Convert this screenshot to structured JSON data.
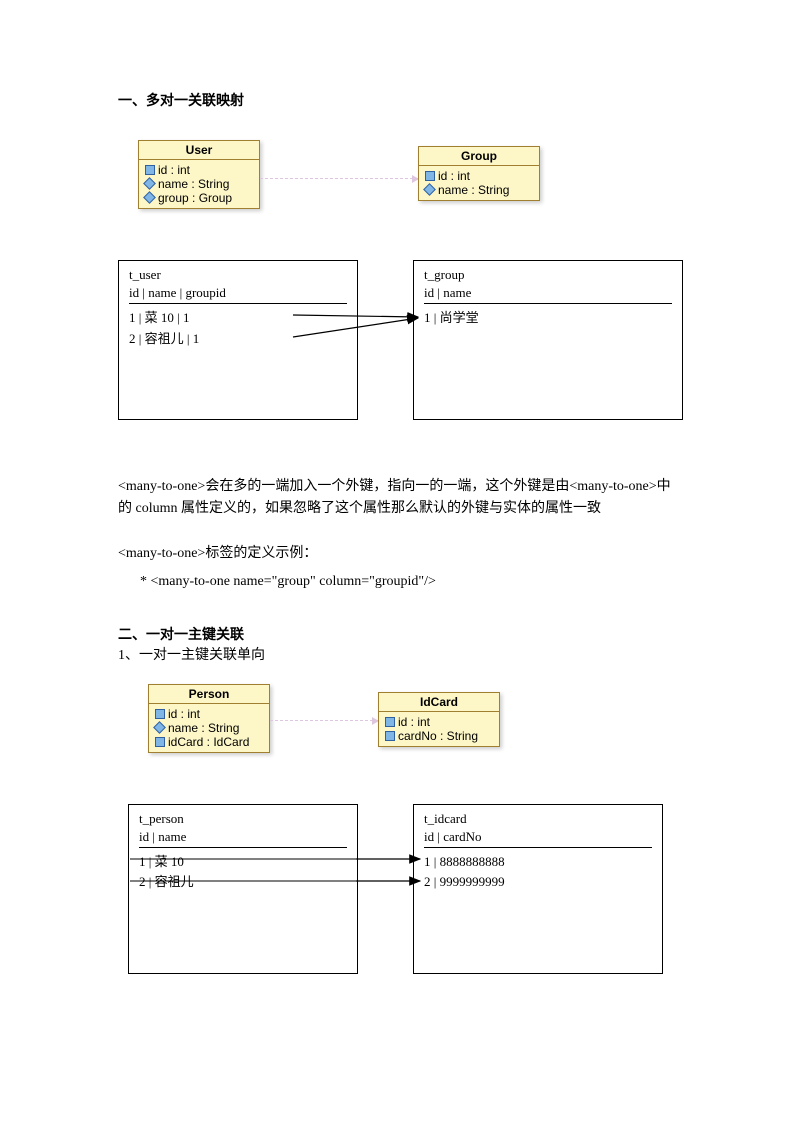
{
  "section1": {
    "heading": "一、多对一关联映射",
    "uml": {
      "user": {
        "title": "User",
        "attrs": [
          "id : int",
          "name : String",
          "group : Group"
        ]
      },
      "group": {
        "title": "Group",
        "attrs": [
          "id : int",
          "name : String"
        ]
      }
    },
    "tables": {
      "t_user": {
        "name": "t_user",
        "header": "id      |      name     |     groupid",
        "rows": [
          "1       |    菜 10       |     1",
          "2       |    容祖儿    |     1"
        ]
      },
      "t_group": {
        "name": "t_group",
        "header": "id        |        name",
        "rows": [
          "1         |    尚学堂"
        ]
      }
    },
    "p1": "<many-to-one>会在多的一端加入一个外键，指向一的一端，这个外键是由<many-to-one>中的 column 属性定义的，如果忽略了这个属性那么默认的外键与实体的属性一致",
    "p2": "<many-to-one>标签的定义示例：",
    "p3": "* <many-to-one name=\"group\" column=\"groupid\"/>"
  },
  "section2": {
    "heading": "二、一对一主键关联",
    "sub": "1、一对一主键关联单向",
    "uml": {
      "person": {
        "title": "Person",
        "attrs": [
          "id : int",
          "name : String",
          "idCard : IdCard"
        ]
      },
      "idcard": {
        "title": "IdCard",
        "attrs": [
          "id : int",
          "cardNo : String"
        ]
      }
    },
    "tables": {
      "t_person": {
        "name": "t_person",
        "header": "id        |          name",
        "rows": [
          "1         |     菜 10",
          "2         |     容祖儿"
        ]
      },
      "t_idcard": {
        "name": "t_idcard",
        "header": "id        |          cardNo",
        "rows": [
          "1         |     8888888888",
          "2         |     9999999999"
        ]
      }
    }
  }
}
